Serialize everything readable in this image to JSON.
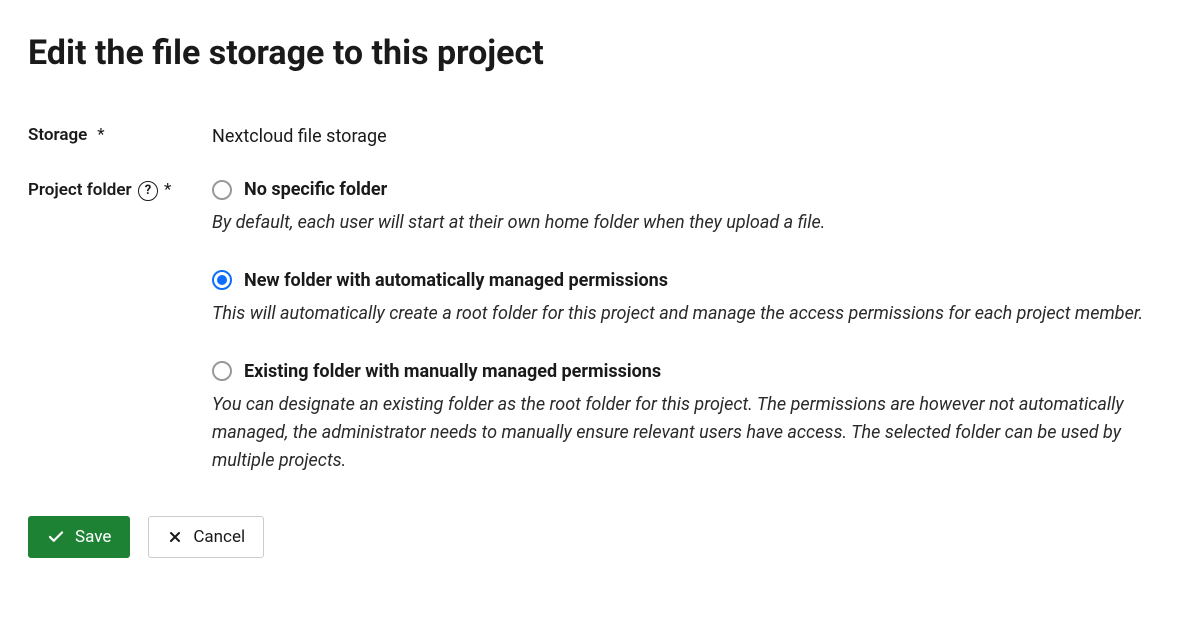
{
  "title": "Edit the file storage to this project",
  "fields": {
    "storage": {
      "label": "Storage",
      "required": "*",
      "value": "Nextcloud file storage"
    },
    "project_folder": {
      "label": "Project folder",
      "required": "*",
      "help_icon": "?",
      "options": [
        {
          "label": "No specific folder",
          "description": "By default, each user will start at their own home folder when they upload a file.",
          "selected": false
        },
        {
          "label": "New folder with automatically managed permissions",
          "description": "This will automatically create a root folder for this project and manage the access permissions for each project member.",
          "selected": true
        },
        {
          "label": "Existing folder with manually managed permissions",
          "description": "You can designate an existing folder as the root folder for this project. The permissions are however not automatically managed, the administrator needs to manually ensure relevant users have access. The selected folder can be used by multiple projects.",
          "selected": false
        }
      ]
    }
  },
  "buttons": {
    "save": "Save",
    "cancel": "Cancel"
  }
}
